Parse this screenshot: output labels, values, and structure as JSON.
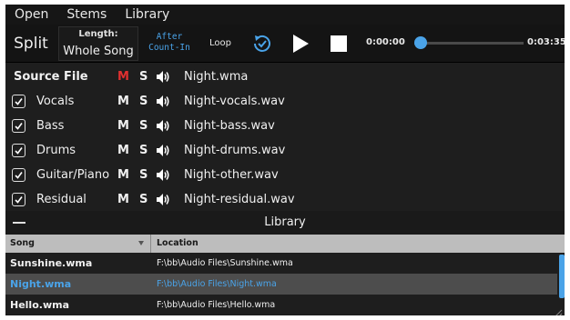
{
  "menu": {
    "items": [
      "Open",
      "Stems",
      "Library"
    ]
  },
  "toolbar": {
    "split_label": "Split",
    "length_label": "Length:",
    "length_value": "Whole Song",
    "after_line1": "After",
    "after_line2": "Count-In",
    "loop_label": "Loop",
    "current_time": "0:00:00",
    "total_time": "0:03:35",
    "playback_position": 0.0
  },
  "stems": {
    "source": {
      "name": "Source File",
      "mute": "M",
      "solo": "S",
      "file": "Night.wma"
    },
    "rows": [
      {
        "name": "Vocals",
        "mute": "M",
        "solo": "S",
        "file": "Night-vocals.wav",
        "checked": true
      },
      {
        "name": "Bass",
        "mute": "M",
        "solo": "S",
        "file": "Night-bass.wav",
        "checked": true
      },
      {
        "name": "Drums",
        "mute": "M",
        "solo": "S",
        "file": "Night-drums.wav",
        "checked": true
      },
      {
        "name": "Guitar/Piano",
        "mute": "M",
        "solo": "S",
        "file": "Night-other.wav",
        "checked": true
      },
      {
        "name": "Residual",
        "mute": "M",
        "solo": "S",
        "file": "Night-residual.wav",
        "checked": true
      }
    ]
  },
  "library": {
    "title": "Library",
    "columns": [
      "Song",
      "Location"
    ],
    "rows": [
      {
        "song": "Sunshine.wma",
        "location": "F:\\bb\\Audio Files\\Sunshine.wma",
        "selected": false
      },
      {
        "song": "Night.wma",
        "location": "F:\\bb\\Audio Files\\Night.wma",
        "selected": true
      },
      {
        "song": "Hello.wma",
        "location": "F:\\bb\\Audio Files\\Hello.wma",
        "selected": false
      }
    ]
  },
  "colors": {
    "accent": "#4aa3e8",
    "mute_active": "#e03030",
    "background": "#1e1e1e",
    "toolbar_bg": "#141414",
    "selected_row": "#4d4d4d"
  },
  "icons": {
    "sync": "sync-check-icon",
    "play": "play-icon",
    "stop": "stop-icon",
    "speaker": "speaker-icon",
    "checkbox": "check-icon",
    "collapse": "minus-icon",
    "sort": "sort-down-icon",
    "resize": "resize-grip-icon"
  }
}
